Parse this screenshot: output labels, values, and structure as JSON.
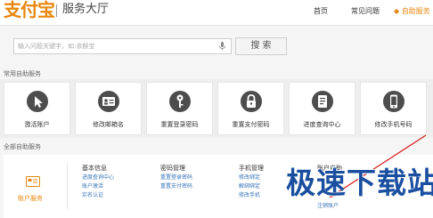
{
  "header": {
    "logo_text": "支付宝",
    "service_title": "服务大厅",
    "nav": [
      "首页",
      "常见问题",
      "◆ 自助服务"
    ]
  },
  "search": {
    "placeholder": "输入问题关键字，如:余额宝",
    "button_label": "搜 索"
  },
  "common_services": {
    "label": "常用自助服务",
    "tiles": [
      {
        "label": "激活账户",
        "icon": "cursor-icon"
      },
      {
        "label": "修改邮箱名",
        "icon": "id-card-icon"
      },
      {
        "label": "重置登录密码",
        "icon": "key-icon"
      },
      {
        "label": "重置支付密码",
        "icon": "lock-icon"
      },
      {
        "label": "进度查询中心",
        "icon": "document-icon"
      },
      {
        "label": "修改手机号码",
        "icon": "phone-icon"
      }
    ]
  },
  "all_services": {
    "label": "全部自助服务",
    "account_service_label": "账户服务",
    "columns": [
      {
        "title": "基本信息",
        "links": [
          "进度查询中心",
          "账户激活",
          "实名认证"
        ]
      },
      {
        "title": "密码管理",
        "links": [
          "重置登录密码",
          "重置支付密码"
        ]
      },
      {
        "title": "手机管理",
        "links": [
          "修改绑定",
          "解绑绑定",
          "修改手机"
        ]
      },
      {
        "title": "账户自助",
        "links": [
          "注销账户"
        ]
      }
    ]
  },
  "watermark": "极速下载站",
  "colors": {
    "accent": "#e8860c",
    "link": "#3a75b8",
    "watermark": "#1a4fa0"
  }
}
